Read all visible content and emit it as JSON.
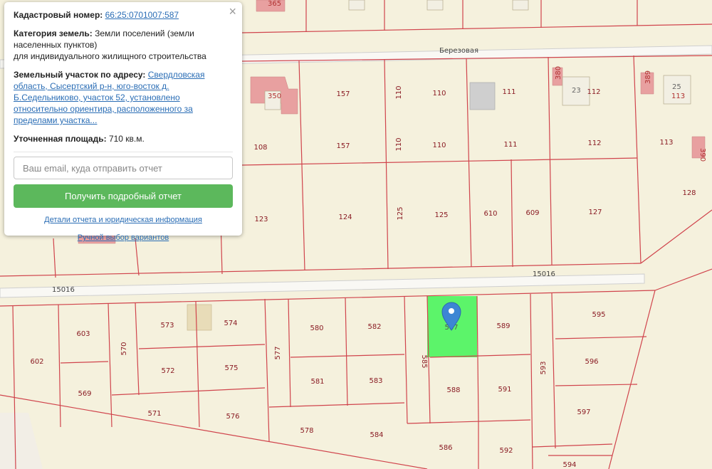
{
  "popup": {
    "close_glyph": "×",
    "cadastral_label": "Кадастровый номер:",
    "cadastral_number": "66:25:0701007:587",
    "category_label": "Категория земель:",
    "category_value": "Земли поселений (земли населенных пунктов)",
    "category_use": "для индивидуального жилищного строительства",
    "address_label": "Земельный участок по адресу:",
    "address_value": "Свердловская область, Сысертский р-н, юго-восток д. Б.Седельниково, участок 52, установлено относительно ориентира, расположенного за пределами участка...",
    "area_label": "Уточненная площадь:",
    "area_value": "710 кв.м.",
    "email_placeholder": "Ваш email, куда отправить отчет",
    "report_button": "Получить подробный отчет",
    "details_link": "Детали отчета и юридическая информация",
    "manual_link": "Ручной выбор вариантов"
  },
  "map": {
    "roads": [
      "Березовая",
      "15016",
      "15016"
    ],
    "buildings": [
      "365",
      "350",
      "380",
      "23",
      "389",
      "25",
      "113",
      "390"
    ],
    "plots": [
      "157",
      "157",
      "110",
      "110",
      "110",
      "110",
      "111",
      "111",
      "112",
      "112",
      "113",
      "108",
      "123",
      "124",
      "125",
      "125",
      "610",
      "609",
      "127",
      "128",
      "603",
      "573",
      "574",
      "580",
      "582",
      "587",
      "589",
      "595",
      "602",
      "570",
      "577",
      "585",
      "572",
      "575",
      "581",
      "583",
      "593",
      "596",
      "569",
      "571",
      "576",
      "588",
      "591",
      "597",
      "578",
      "584",
      "586",
      "592",
      "594"
    ],
    "colors": {
      "selected": "#5cf46a",
      "boundary": "#d0444c",
      "building": "#e8a0a0",
      "marker": "#3d86d4"
    }
  }
}
